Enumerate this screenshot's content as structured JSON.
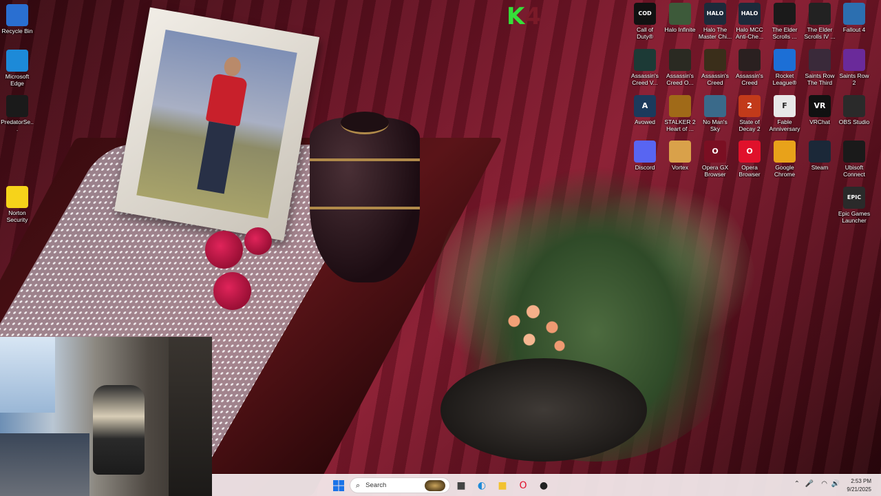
{
  "desktop": {
    "left_icons": [
      {
        "label": "Recycle Bin",
        "icon": "recycle-bin-icon",
        "color": "#2a6fd1"
      },
      {
        "label": "Microsoft Edge",
        "icon": "edge-icon",
        "color": "#1d8ad8"
      },
      {
        "label": "PredatorSe...",
        "icon": "predator-sense-icon",
        "color": "#1a1a1a"
      },
      {
        "label": "Norton Security Ultra",
        "icon": "norton-icon",
        "color": "#f6d31a"
      }
    ],
    "right_icons": [
      {
        "label": "Call of Duty®",
        "icon": "call-of-duty-icon",
        "color": "#111111",
        "glyph": "COD"
      },
      {
        "label": "Halo Infinite",
        "icon": "halo-infinite-icon",
        "color": "#3d5a3a",
        "glyph": ""
      },
      {
        "label": "Halo The Master Chi...",
        "icon": "halo-mcc-icon",
        "color": "#1d2a3a",
        "glyph": "HALO"
      },
      {
        "label": "Halo MCC Anti-Che...",
        "icon": "halo-mcc-anticheat-icon",
        "color": "#1d2a3a",
        "glyph": "HALO"
      },
      {
        "label": "The Elder Scrolls ...",
        "icon": "elder-scrolls-icon",
        "color": "#1a1a1a",
        "glyph": ""
      },
      {
        "label": "The Elder Scrolls IV ...",
        "icon": "oblivion-icon",
        "color": "#222222",
        "glyph": ""
      },
      {
        "label": "Fallout 4",
        "icon": "fallout-4-icon",
        "color": "#2c6fb0",
        "glyph": ""
      },
      {
        "label": "Assassin's Creed V...",
        "icon": "assassins-creed-valhalla-icon",
        "color": "#1c3a36",
        "glyph": ""
      },
      {
        "label": "Assassin's Creed O...",
        "icon": "assassins-creed-odyssey-icon",
        "color": "#2a2a22",
        "glyph": ""
      },
      {
        "label": "Assassin's Creed Origins",
        "icon": "assassins-creed-origins-icon",
        "color": "#3a2e1a",
        "glyph": ""
      },
      {
        "label": "Assassin's Creed Mirage",
        "icon": "assassins-creed-mirage-icon",
        "color": "#2a2020",
        "glyph": ""
      },
      {
        "label": "Rocket League®",
        "icon": "rocket-league-icon",
        "color": "#1c6fd6",
        "glyph": ""
      },
      {
        "label": "Saints Row The Third",
        "icon": "saints-row-third-icon",
        "color": "#3a2a3a",
        "glyph": ""
      },
      {
        "label": "Saints Row 2",
        "icon": "saints-row-2-icon",
        "color": "#6a2a9a",
        "glyph": ""
      },
      {
        "label": "Avowed",
        "icon": "avowed-icon",
        "color": "#1b3a5c",
        "glyph": "A"
      },
      {
        "label": "STALKER 2 Heart of ...",
        "icon": "stalker-2-icon",
        "color": "#a06a18",
        "glyph": ""
      },
      {
        "label": "No Man's Sky",
        "icon": "no-mans-sky-icon",
        "color": "#3a6a8a",
        "glyph": ""
      },
      {
        "label": "State of Decay 2",
        "icon": "state-of-decay-2-icon",
        "color": "#c23a1a",
        "glyph": "2"
      },
      {
        "label": "Fable Anniversary",
        "icon": "fable-anniversary-icon",
        "color": "#e8e8e8",
        "glyph": "F"
      },
      {
        "label": "VRChat",
        "icon": "vrchat-icon",
        "color": "#111111",
        "glyph": "VR"
      },
      {
        "label": "OBS Studio",
        "icon": "obs-studio-icon",
        "color": "#2a2a2a",
        "glyph": ""
      },
      {
        "label": "Discord",
        "icon": "discord-icon",
        "color": "#5865f2",
        "glyph": ""
      },
      {
        "label": "Vortex",
        "icon": "vortex-icon",
        "color": "#d9a14a",
        "glyph": ""
      },
      {
        "label": "Opera GX Browser",
        "icon": "opera-gx-icon",
        "color": "#7a0f22",
        "glyph": "O"
      },
      {
        "label": "Opera Browser",
        "icon": "opera-icon",
        "color": "#e0112b",
        "glyph": "O"
      },
      {
        "label": "Google Chrome",
        "icon": "google-chrome-icon",
        "color": "#e8a21a",
        "glyph": ""
      },
      {
        "label": "Steam",
        "icon": "steam-icon",
        "color": "#1b2838",
        "glyph": ""
      },
      {
        "label": "Ubisoft Connect",
        "icon": "ubisoft-connect-icon",
        "color": "#1a1a1a",
        "glyph": ""
      },
      {
        "label": "Epic Games Launcher",
        "icon": "epic-games-icon",
        "color": "#2a2a2a",
        "glyph": "EPIC"
      }
    ]
  },
  "taskbar": {
    "search_placeholder": "Search",
    "apps": [
      {
        "name": "task-view-icon",
        "glyph": "■",
        "color": "#444444"
      },
      {
        "name": "edge-taskbar-icon",
        "glyph": "◐",
        "color": "#1d8ad8"
      },
      {
        "name": "file-explorer-icon",
        "glyph": "■",
        "color": "#f2c230"
      },
      {
        "name": "opera-taskbar-icon",
        "glyph": "O",
        "color": "#e0112b"
      },
      {
        "name": "obs-taskbar-icon",
        "glyph": "●",
        "color": "#222222"
      }
    ],
    "clock": {
      "time": "2:53 PM",
      "date": "9/21/2025"
    }
  }
}
